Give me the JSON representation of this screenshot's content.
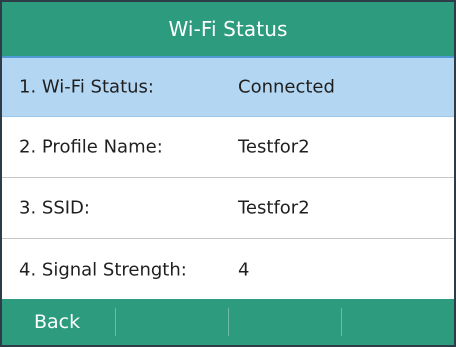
{
  "header": {
    "title": "Wi-Fi Status"
  },
  "status_items": [
    {
      "label": "1. Wi-Fi Status:",
      "value": "Connected",
      "selected": true
    },
    {
      "label": "2. Profile Name:",
      "value": "Testfor2",
      "selected": false
    },
    {
      "label": "3. SSID:",
      "value": "Testfor2",
      "selected": false
    },
    {
      "label": "4. Signal Strength:",
      "value": "4",
      "selected": false
    }
  ],
  "softkeys": [
    {
      "label": "Back"
    },
    {
      "label": ""
    },
    {
      "label": ""
    },
    {
      "label": ""
    }
  ],
  "colors": {
    "bar_green": "#2d9b7e",
    "selected_row": "#b3d6f2",
    "row_divider": "#c6c6c6",
    "text": "#1f1f1f",
    "bar_text": "#ffffff"
  }
}
